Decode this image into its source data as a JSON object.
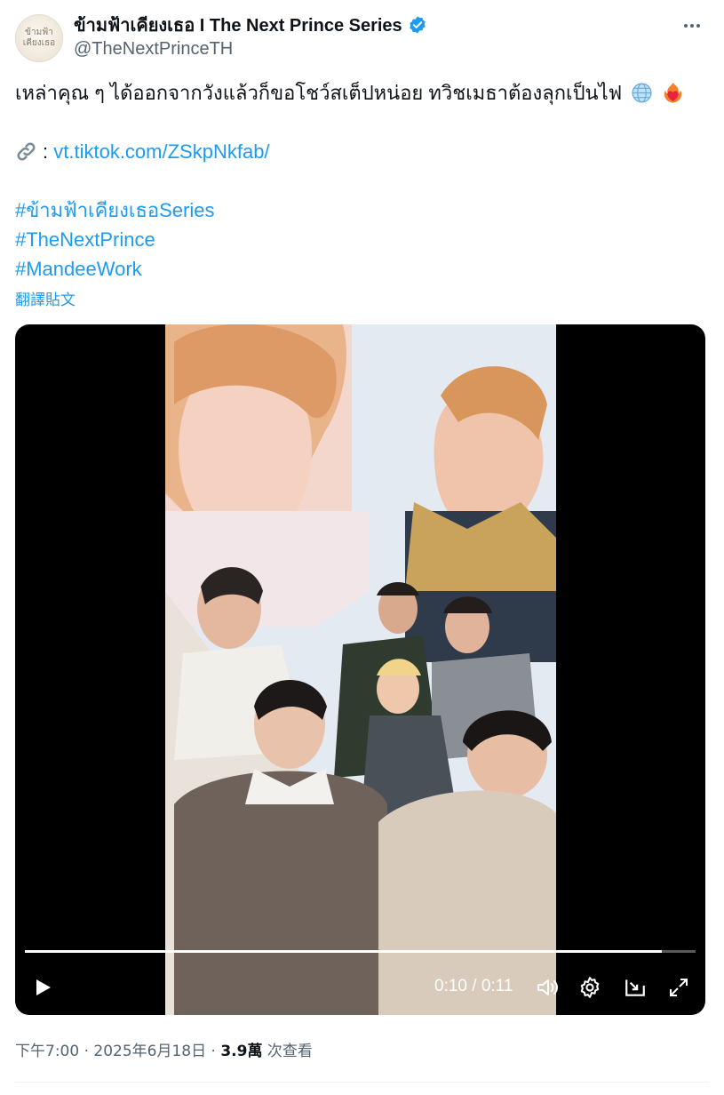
{
  "author": {
    "display_name": "ข้ามฟ้าเคียงเธอ I The Next Prince Series",
    "handle": "@TheNextPrinceTH",
    "avatar_text": [
      "ข้ามฟ้า",
      "เคียงเธอ"
    ],
    "verified_icon": "verified-badge-icon"
  },
  "tweet": {
    "text_line1": "เหล่าคุณ ๆ ได้ออกจากวังแล้วก็ขอโชว์สเต็ปหน่อย ทวิชเมธาต้องลุกเป็นไฟ",
    "emoji_1": "globe-icon",
    "emoji_2": "heart-on-fire-icon",
    "link_prefix": ":",
    "link_icon": "link-icon",
    "link_text": "vt.tiktok.com/ZSkpNkfab/",
    "hashtags": [
      "#ข้ามฟ้าเคียงเธอSeries",
      "#TheNextPrince",
      "#MandeeWork"
    ],
    "translate_label": "翻譯貼文"
  },
  "video": {
    "current_time": "0:10",
    "separator": "/",
    "duration": "0:11",
    "progress": 0.95
  },
  "meta": {
    "time": "下午7:00",
    "date": "2025年6月18日",
    "dot": "·",
    "views": "3.9萬",
    "views_label": "次查看"
  },
  "colors": {
    "link": "#1d9bf0",
    "verified": "#1d9bf0",
    "secondary_text": "#536471"
  }
}
